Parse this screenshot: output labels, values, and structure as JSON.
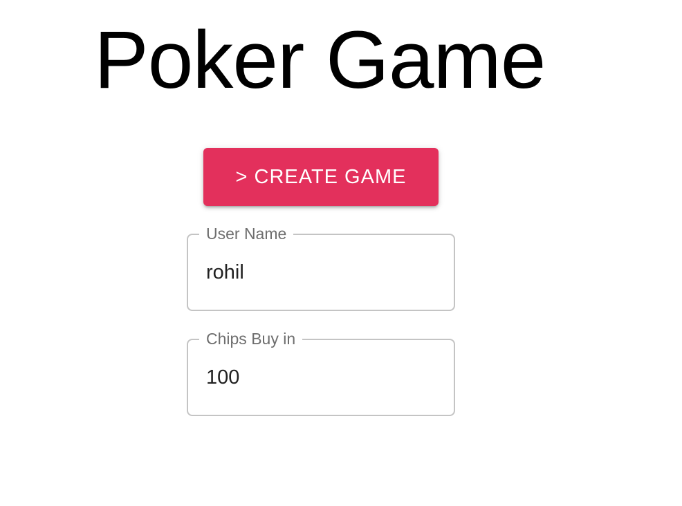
{
  "page": {
    "title": "Poker Game"
  },
  "actions": {
    "create_game_label": "> CREATE GAME",
    "create_game_color": "#e3305c"
  },
  "form": {
    "user_name": {
      "label": "User Name",
      "value": "rohil"
    },
    "chips_buy_in": {
      "label": "Chips Buy in",
      "value": "100"
    }
  }
}
